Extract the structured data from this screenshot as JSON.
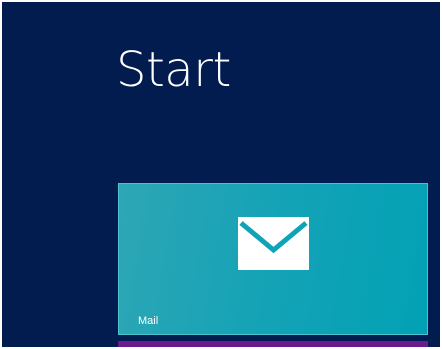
{
  "start_screen": {
    "title": "Start",
    "background_color": "#021c4f"
  },
  "tiles": [
    {
      "label": "Mail",
      "icon": "envelope-icon",
      "color": "#0ba2b5"
    }
  ],
  "next_tile": {
    "color": "#6b1a8f"
  }
}
